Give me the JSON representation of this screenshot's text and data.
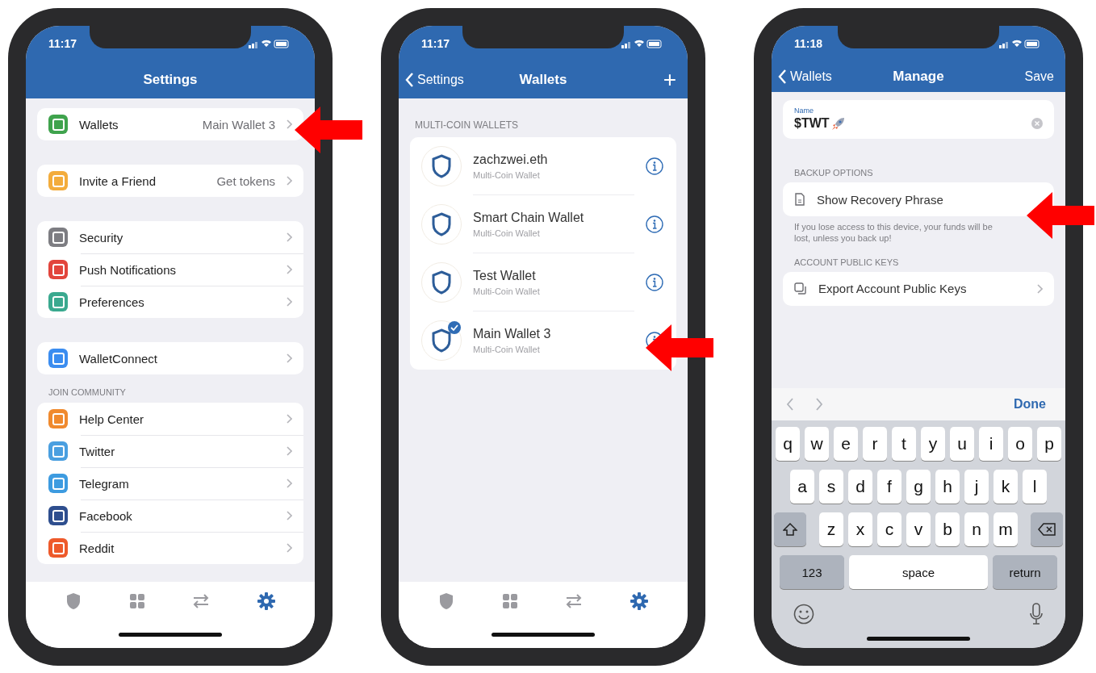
{
  "phones": [
    {
      "kind": "settings",
      "time": "11:17",
      "title": "Settings",
      "groups": [
        {
          "rows": [
            {
              "label": "Wallets",
              "value": "Main Wallet 3",
              "color": "#3fa34d"
            }
          ]
        },
        {
          "rows": [
            {
              "label": "Invite a Friend",
              "value": "Get tokens",
              "color": "#f3ac3c"
            }
          ]
        },
        {
          "rows": [
            {
              "label": "Security",
              "color": "#7d7d82"
            },
            {
              "label": "Push Notifications",
              "color": "#e2453c"
            },
            {
              "label": "Preferences",
              "color": "#3aa98f"
            }
          ]
        },
        {
          "rows": [
            {
              "label": "WalletConnect",
              "color": "#3b8df0"
            }
          ]
        },
        {
          "header": "JOIN COMMUNITY",
          "rows": [
            {
              "label": "Help Center",
              "color": "#f08a2e"
            },
            {
              "label": "Twitter",
              "color": "#4a9fe0"
            },
            {
              "label": "Telegram",
              "color": "#3d9be0"
            },
            {
              "label": "Facebook",
              "color": "#2e4e8e"
            },
            {
              "label": "Reddit",
              "color": "#ee5a2b"
            }
          ]
        }
      ],
      "tabs": [
        {
          "selected": false
        },
        {
          "selected": false
        },
        {
          "selected": false
        },
        {
          "selected": true
        }
      ]
    },
    {
      "kind": "wallets",
      "time": "11:17",
      "back": "Settings",
      "title": "Wallets",
      "action": "+",
      "section": "MULTI-COIN WALLETS",
      "wallets": [
        {
          "name": "zachzwei.eth",
          "type": "Multi-Coin Wallet",
          "selected": false
        },
        {
          "name": "Smart Chain Wallet",
          "type": "Multi-Coin Wallet",
          "selected": false
        },
        {
          "name": "Test Wallet",
          "type": "Multi-Coin Wallet",
          "selected": false
        },
        {
          "name": "Main Wallet 3",
          "type": "Multi-Coin Wallet",
          "selected": true
        }
      ],
      "tabs": [
        {
          "selected": false
        },
        {
          "selected": false
        },
        {
          "selected": false
        },
        {
          "selected": true
        }
      ]
    },
    {
      "kind": "manage",
      "time": "11:18",
      "back": "Wallets",
      "title": "Manage",
      "action": "Save",
      "name_field": {
        "label": "Name",
        "value": "$TWT"
      },
      "sections": [
        {
          "header": "BACKUP OPTIONS",
          "row": "Show Recovery Phrase",
          "note": "If you lose access to this device, your funds will be lost, unless you back up!"
        },
        {
          "header": "ACCOUNT PUBLIC KEYS",
          "row": "Export Account Public Keys"
        }
      ],
      "keyboard": {
        "done": "Done",
        "rows": [
          [
            "q",
            "w",
            "e",
            "r",
            "t",
            "y",
            "u",
            "i",
            "o",
            "p"
          ],
          [
            "a",
            "s",
            "d",
            "f",
            "g",
            "h",
            "j",
            "k",
            "l"
          ],
          [
            "z",
            "x",
            "c",
            "v",
            "b",
            "n",
            "m"
          ]
        ],
        "numbers": "123",
        "space": "space",
        "return": "return"
      }
    }
  ]
}
